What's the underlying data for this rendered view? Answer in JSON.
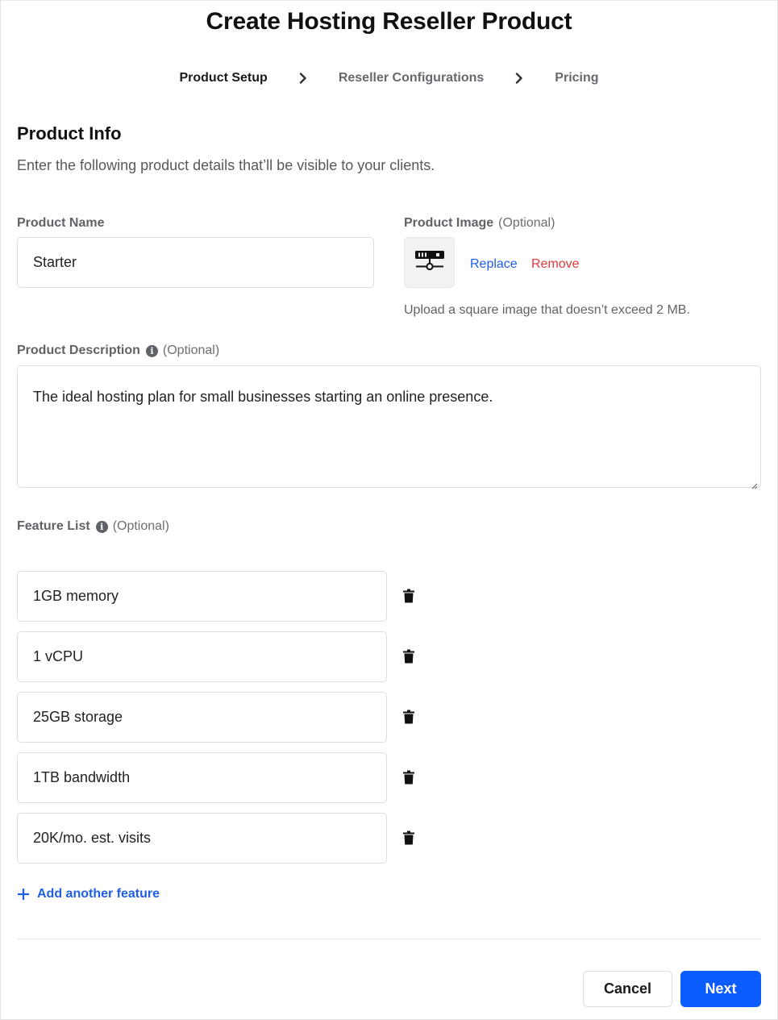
{
  "header": {
    "title": "Create Hosting Reseller Product"
  },
  "stepper": {
    "steps": [
      {
        "label": "Product Setup",
        "active": true
      },
      {
        "label": "Reseller Configurations",
        "active": false
      },
      {
        "label": "Pricing",
        "active": false
      }
    ],
    "separator_icon": "chevron-right-icon"
  },
  "section": {
    "title": "Product Info",
    "subtitle": "Enter the following product details that’ll be visible to your clients."
  },
  "product_name": {
    "label": "Product Name",
    "value": "Starter"
  },
  "product_image": {
    "label": "Product Image",
    "optional": "(Optional)",
    "icon": "server-network-icon",
    "replace_label": "Replace",
    "remove_label": "Remove",
    "hint": "Upload a square image that doesn’t exceed 2 MB."
  },
  "product_description": {
    "label": "Product Description",
    "optional": "(Optional)",
    "info_icon": "info-icon",
    "value": "The ideal hosting plan for small businesses starting an online presence."
  },
  "feature_list": {
    "label": "Feature List",
    "optional": "(Optional)",
    "info_icon": "info-icon",
    "items": [
      {
        "value": "1GB memory"
      },
      {
        "value": "1 vCPU"
      },
      {
        "value": "25GB storage"
      },
      {
        "value": "1TB bandwidth"
      },
      {
        "value": "20K/mo. est. visits"
      }
    ],
    "delete_icon": "trash-icon",
    "add_label": "Add another feature"
  },
  "footer": {
    "cancel_label": "Cancel",
    "next_label": "Next"
  },
  "colors": {
    "primary": "#0a5cff",
    "link": "#1f5fe6",
    "danger": "#e0393e"
  }
}
